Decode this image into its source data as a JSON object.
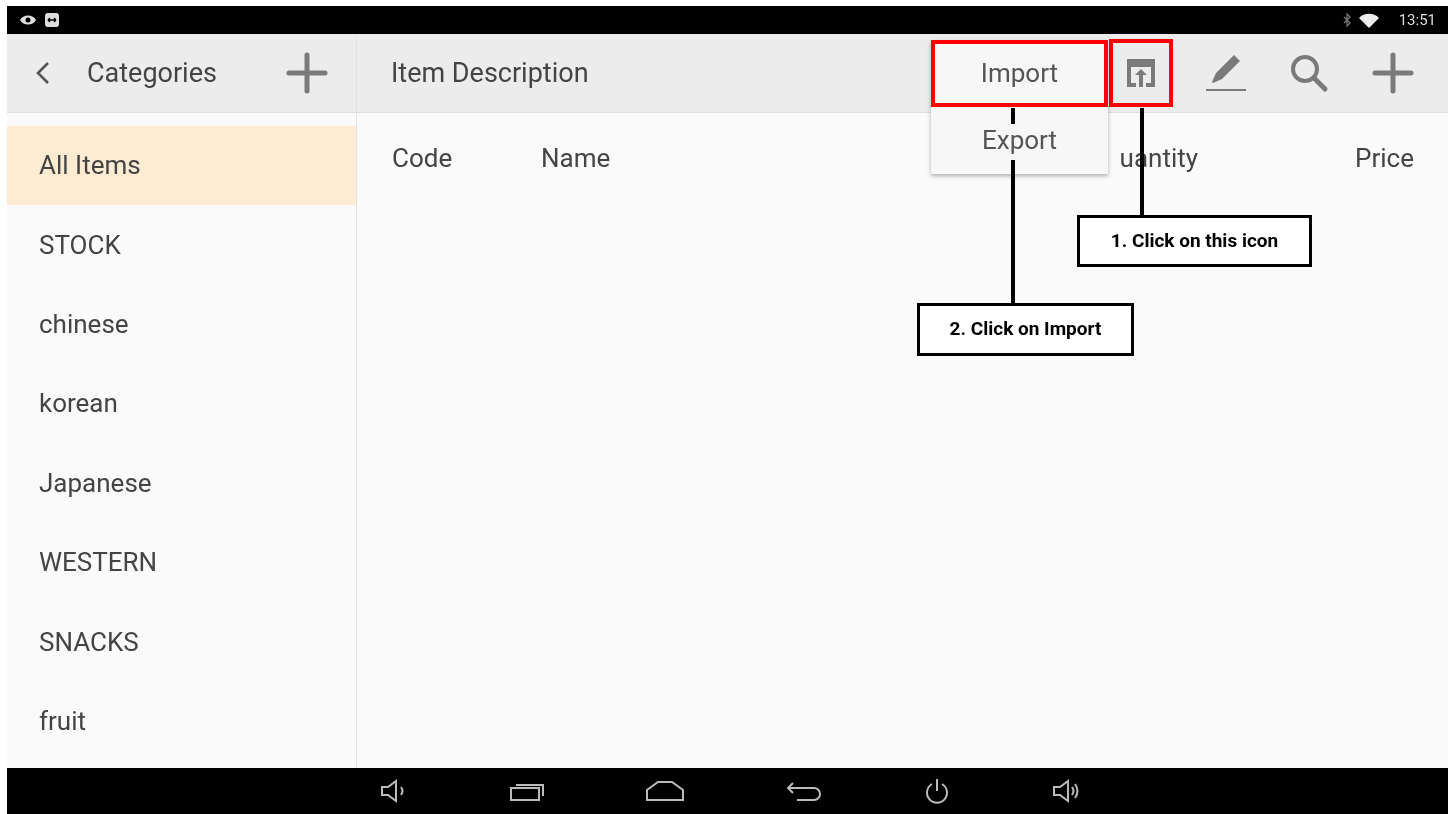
{
  "status_bar": {
    "time": "13:51"
  },
  "sidebar": {
    "title": "Categories",
    "items": [
      {
        "label": "All Items",
        "selected": true
      },
      {
        "label": "STOCK",
        "selected": false
      },
      {
        "label": "chinese",
        "selected": false
      },
      {
        "label": "korean",
        "selected": false
      },
      {
        "label": "Japanese",
        "selected": false
      },
      {
        "label": "WESTERN",
        "selected": false
      },
      {
        "label": "SNACKS",
        "selected": false
      },
      {
        "label": "fruit",
        "selected": false
      }
    ]
  },
  "main": {
    "title": "Item Description",
    "toolbar": [
      {
        "kind": "upload",
        "highlighted": true
      },
      {
        "kind": "edit",
        "highlighted": false
      },
      {
        "kind": "search",
        "highlighted": false
      },
      {
        "kind": "add",
        "highlighted": false
      }
    ],
    "columns": [
      "Code",
      "Name",
      "uantity",
      "Price"
    ]
  },
  "menu": {
    "items": [
      {
        "label": "Import",
        "highlighted": true
      },
      {
        "label": "Export",
        "highlighted": false
      }
    ]
  },
  "annotations": [
    {
      "text": "1. Click on this icon"
    },
    {
      "text": "2. Click on Import"
    }
  ]
}
